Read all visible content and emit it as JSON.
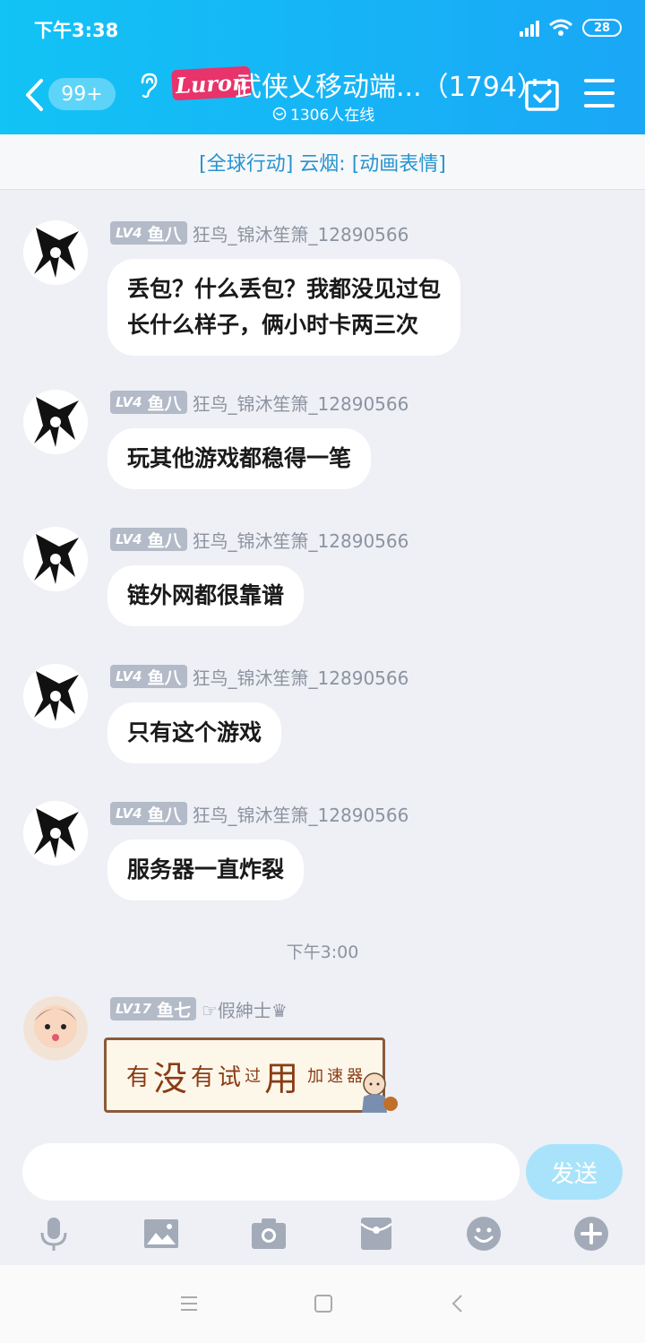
{
  "status": {
    "time": "下午3:38",
    "battery": "28"
  },
  "header": {
    "unread_badge": "99+",
    "logo_text": "Luron",
    "title": "武侠乂移动端...（1794）",
    "online": "1306人在线"
  },
  "announcement": "[全球行动] 云烟: [动画表情]",
  "messages": [
    {
      "level": "LV4",
      "title": "鱼八",
      "nick": "狂鸟_锦沐笙箫_12890566",
      "lines": [
        "丢包？什么丢包？我都没见过包",
        "长什么样子，俩小时卡两三次"
      ]
    },
    {
      "level": "LV4",
      "title": "鱼八",
      "nick": "狂鸟_锦沐笙箫_12890566",
      "lines": [
        "玩其他游戏都稳得一笔"
      ]
    },
    {
      "level": "LV4",
      "title": "鱼八",
      "nick": "狂鸟_锦沐笙箫_12890566",
      "lines": [
        "链外网都很靠谱"
      ]
    },
    {
      "level": "LV4",
      "title": "鱼八",
      "nick": "狂鸟_锦沐笙箫_12890566",
      "lines": [
        "只有这个游戏"
      ]
    },
    {
      "level": "LV4",
      "title": "鱼八",
      "nick": "狂鸟_锦沐笙箫_12890566",
      "lines": [
        "服务器一直炸裂"
      ]
    }
  ],
  "time_separator": "下午3:00",
  "last_message": {
    "level": "LV17",
    "title": "鱼七",
    "nick": "☞假紳士♛",
    "sticker": [
      "有",
      "没",
      "有",
      "试",
      "过",
      "用",
      "加",
      "速",
      "器"
    ]
  },
  "input": {
    "placeholder": "",
    "send_label": "发送"
  },
  "icons": [
    "mic-icon",
    "image-icon",
    "camera-icon",
    "red-packet-icon",
    "emoji-icon",
    "plus-icon"
  ],
  "colors": {
    "header_start": "#12c3f5",
    "header_end": "#1aa7f6",
    "announce_text": "#2794d0",
    "send_button": "#a9e3fb"
  }
}
